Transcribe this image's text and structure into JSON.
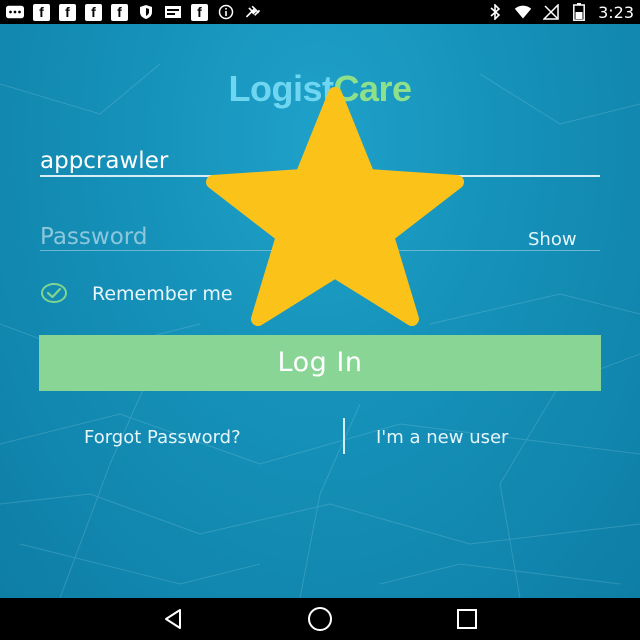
{
  "status_bar": {
    "time": "3:23",
    "icons": [
      "message-icon",
      "facebook-icon",
      "facebook-icon",
      "facebook-icon",
      "facebook-icon",
      "shield-icon",
      "mail-icon",
      "facebook-icon",
      "info-icon",
      "satellite-icon",
      "bluetooth-icon",
      "wifi-icon",
      "no-sim-icon",
      "battery-icon"
    ],
    "facebook_glyph": "f"
  },
  "logo": {
    "part1": "Logist",
    "part2": "Care"
  },
  "login_form": {
    "username_value": "appcrawler",
    "password_placeholder": "Password",
    "show_label": "Show",
    "remember_label": "Remember me",
    "remember_checked": true,
    "login_label": "Log In"
  },
  "links": {
    "forgot_password": "Forgot Password?",
    "new_user": "I'm a new user"
  },
  "colors": {
    "background": "#1590b8",
    "login_button": "#88d595",
    "logo_blue": "#6fd6f2",
    "logo_green": "#8ee08a",
    "star": "#fbc21a"
  },
  "overlay": {
    "icon": "star-icon"
  },
  "nav_bar": {
    "buttons": [
      "back-icon",
      "home-icon",
      "recents-icon"
    ]
  }
}
